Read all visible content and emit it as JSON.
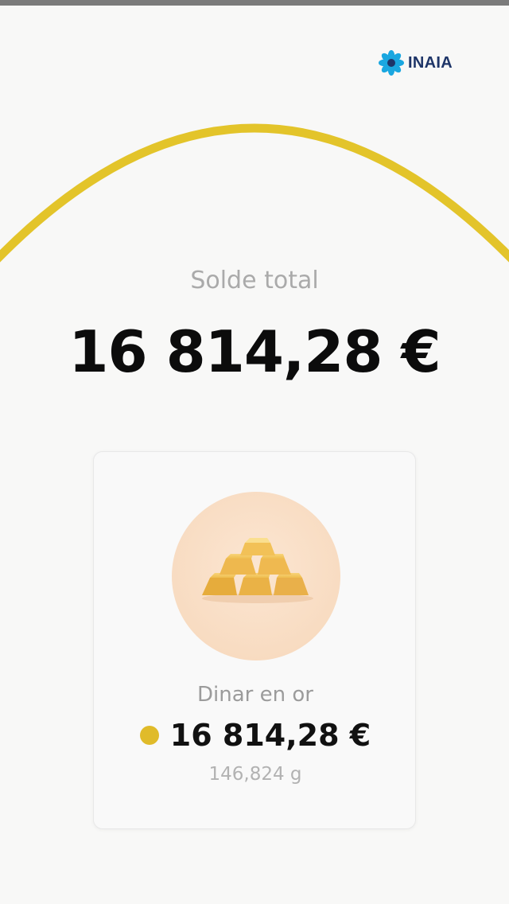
{
  "brand": {
    "name": "INAIA",
    "logo_icon": "flower-logo-icon",
    "name_color": "#1e3568",
    "logo_color": "#1aa7e0"
  },
  "balance": {
    "label": "Solde total",
    "value": "16 814,28 €",
    "arc_color": "#e3c42a"
  },
  "asset": {
    "icon": "gold-bars-icon",
    "name": "Dinar en or",
    "value": "16 814,28 €",
    "weight": "146,824 g",
    "dot_color": "#e0bb2a"
  }
}
